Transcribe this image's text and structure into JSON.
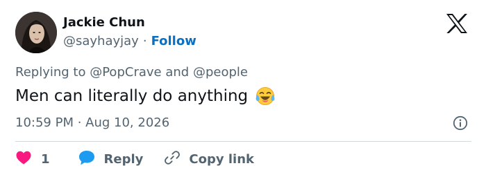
{
  "tweet": {
    "author": {
      "display_name": "Jackie Chun",
      "handle": "@sayhayjay",
      "follow_label": "Follow",
      "separator": "·"
    },
    "reply_context": {
      "prefix": "Replying to",
      "mention_1": "@PopCrave",
      "conjunction": "and",
      "mention_2": "@people"
    },
    "text": "Men can literally do anything",
    "emoji": "face-with-tears-of-joy",
    "timestamp": "10:59 PM · Aug 10, 2026",
    "actions": {
      "like_count": "1",
      "reply_label": "Reply",
      "copy_link_label": "Copy link"
    },
    "icons": {
      "platform_logo": "x-logo-icon",
      "info": "info-icon",
      "like": "heart-icon",
      "reply": "speech-bubble-icon",
      "copy_link": "link-icon"
    },
    "colors": {
      "text_primary": "#0f1419",
      "text_secondary": "#536471",
      "follow": "#0b6fc2",
      "like": "#f91880",
      "reply_icon": "#1d9bf0",
      "divider": "#cfd9de"
    }
  }
}
